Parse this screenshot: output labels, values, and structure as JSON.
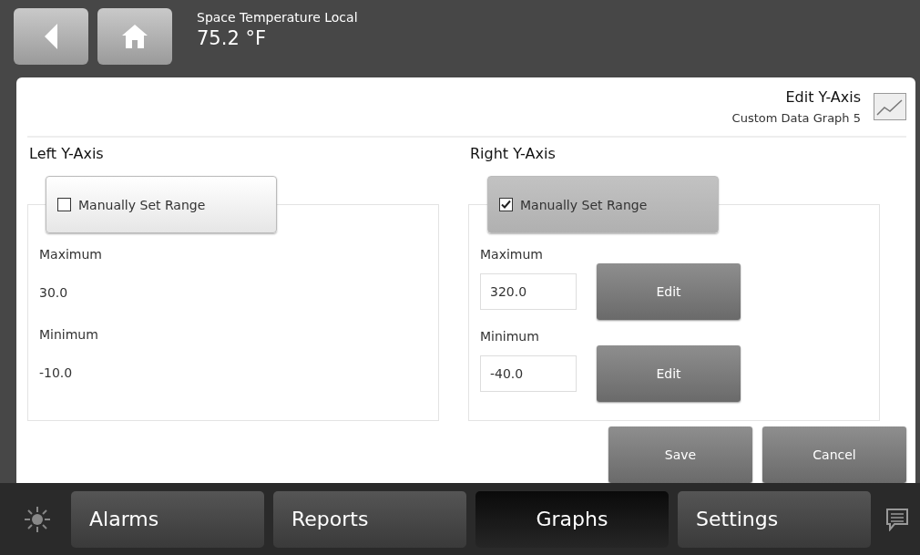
{
  "header": {
    "point_name": "Space Temperature Local",
    "point_value": "75.2 °F"
  },
  "panel": {
    "title": "Edit Y-Axis",
    "subtitle": "Custom Data Graph 5"
  },
  "axes": [
    {
      "title": "Left Y-Axis",
      "manual": {
        "label": "Manually Set Range",
        "checked": false
      },
      "maximum": {
        "label": "Maximum",
        "value": "30.0"
      },
      "minimum": {
        "label": "Minimum",
        "value": "-10.0"
      }
    },
    {
      "title": "Right Y-Axis",
      "manual": {
        "label": "Manually Set Range",
        "checked": true
      },
      "maximum": {
        "label": "Maximum",
        "value": "320.0",
        "edit_button": "Edit"
      },
      "minimum": {
        "label": "Minimum",
        "value": "-40.0",
        "edit_button": "Edit"
      }
    }
  ],
  "actions": [
    "Save",
    "Cancel"
  ],
  "tabs": [
    {
      "label": "Alarms",
      "selected": false
    },
    {
      "label": "Reports",
      "selected": false
    },
    {
      "label": "Graphs",
      "selected": true
    },
    {
      "label": "Settings",
      "selected": false
    }
  ]
}
